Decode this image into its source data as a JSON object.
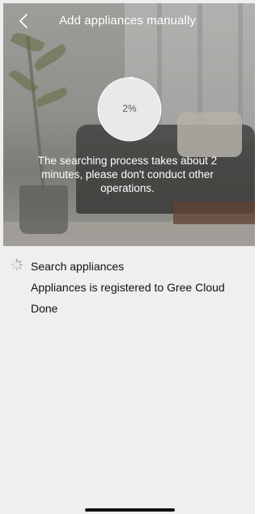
{
  "header": {
    "title": "Add appliances manually",
    "back_icon": "chevron-left-icon"
  },
  "progress": {
    "percent_label": "2%",
    "value": 0.02,
    "message": "The searching process takes about 2 minutes, please don't conduct other operations."
  },
  "steps": [
    {
      "label": "Search appliances",
      "icon": "spinner-icon",
      "status": "in-progress"
    },
    {
      "label": "Appliances is registered to Gree Cloud",
      "status": "pending"
    },
    {
      "label": "Done",
      "status": "pending"
    }
  ],
  "colors": {
    "panel_background": "#eeefee",
    "text_primary": "#111111",
    "text_on_image": "#ffffff",
    "progress_circle_fill": "#e9e9ec",
    "progress_text": "#5a5a5a"
  }
}
